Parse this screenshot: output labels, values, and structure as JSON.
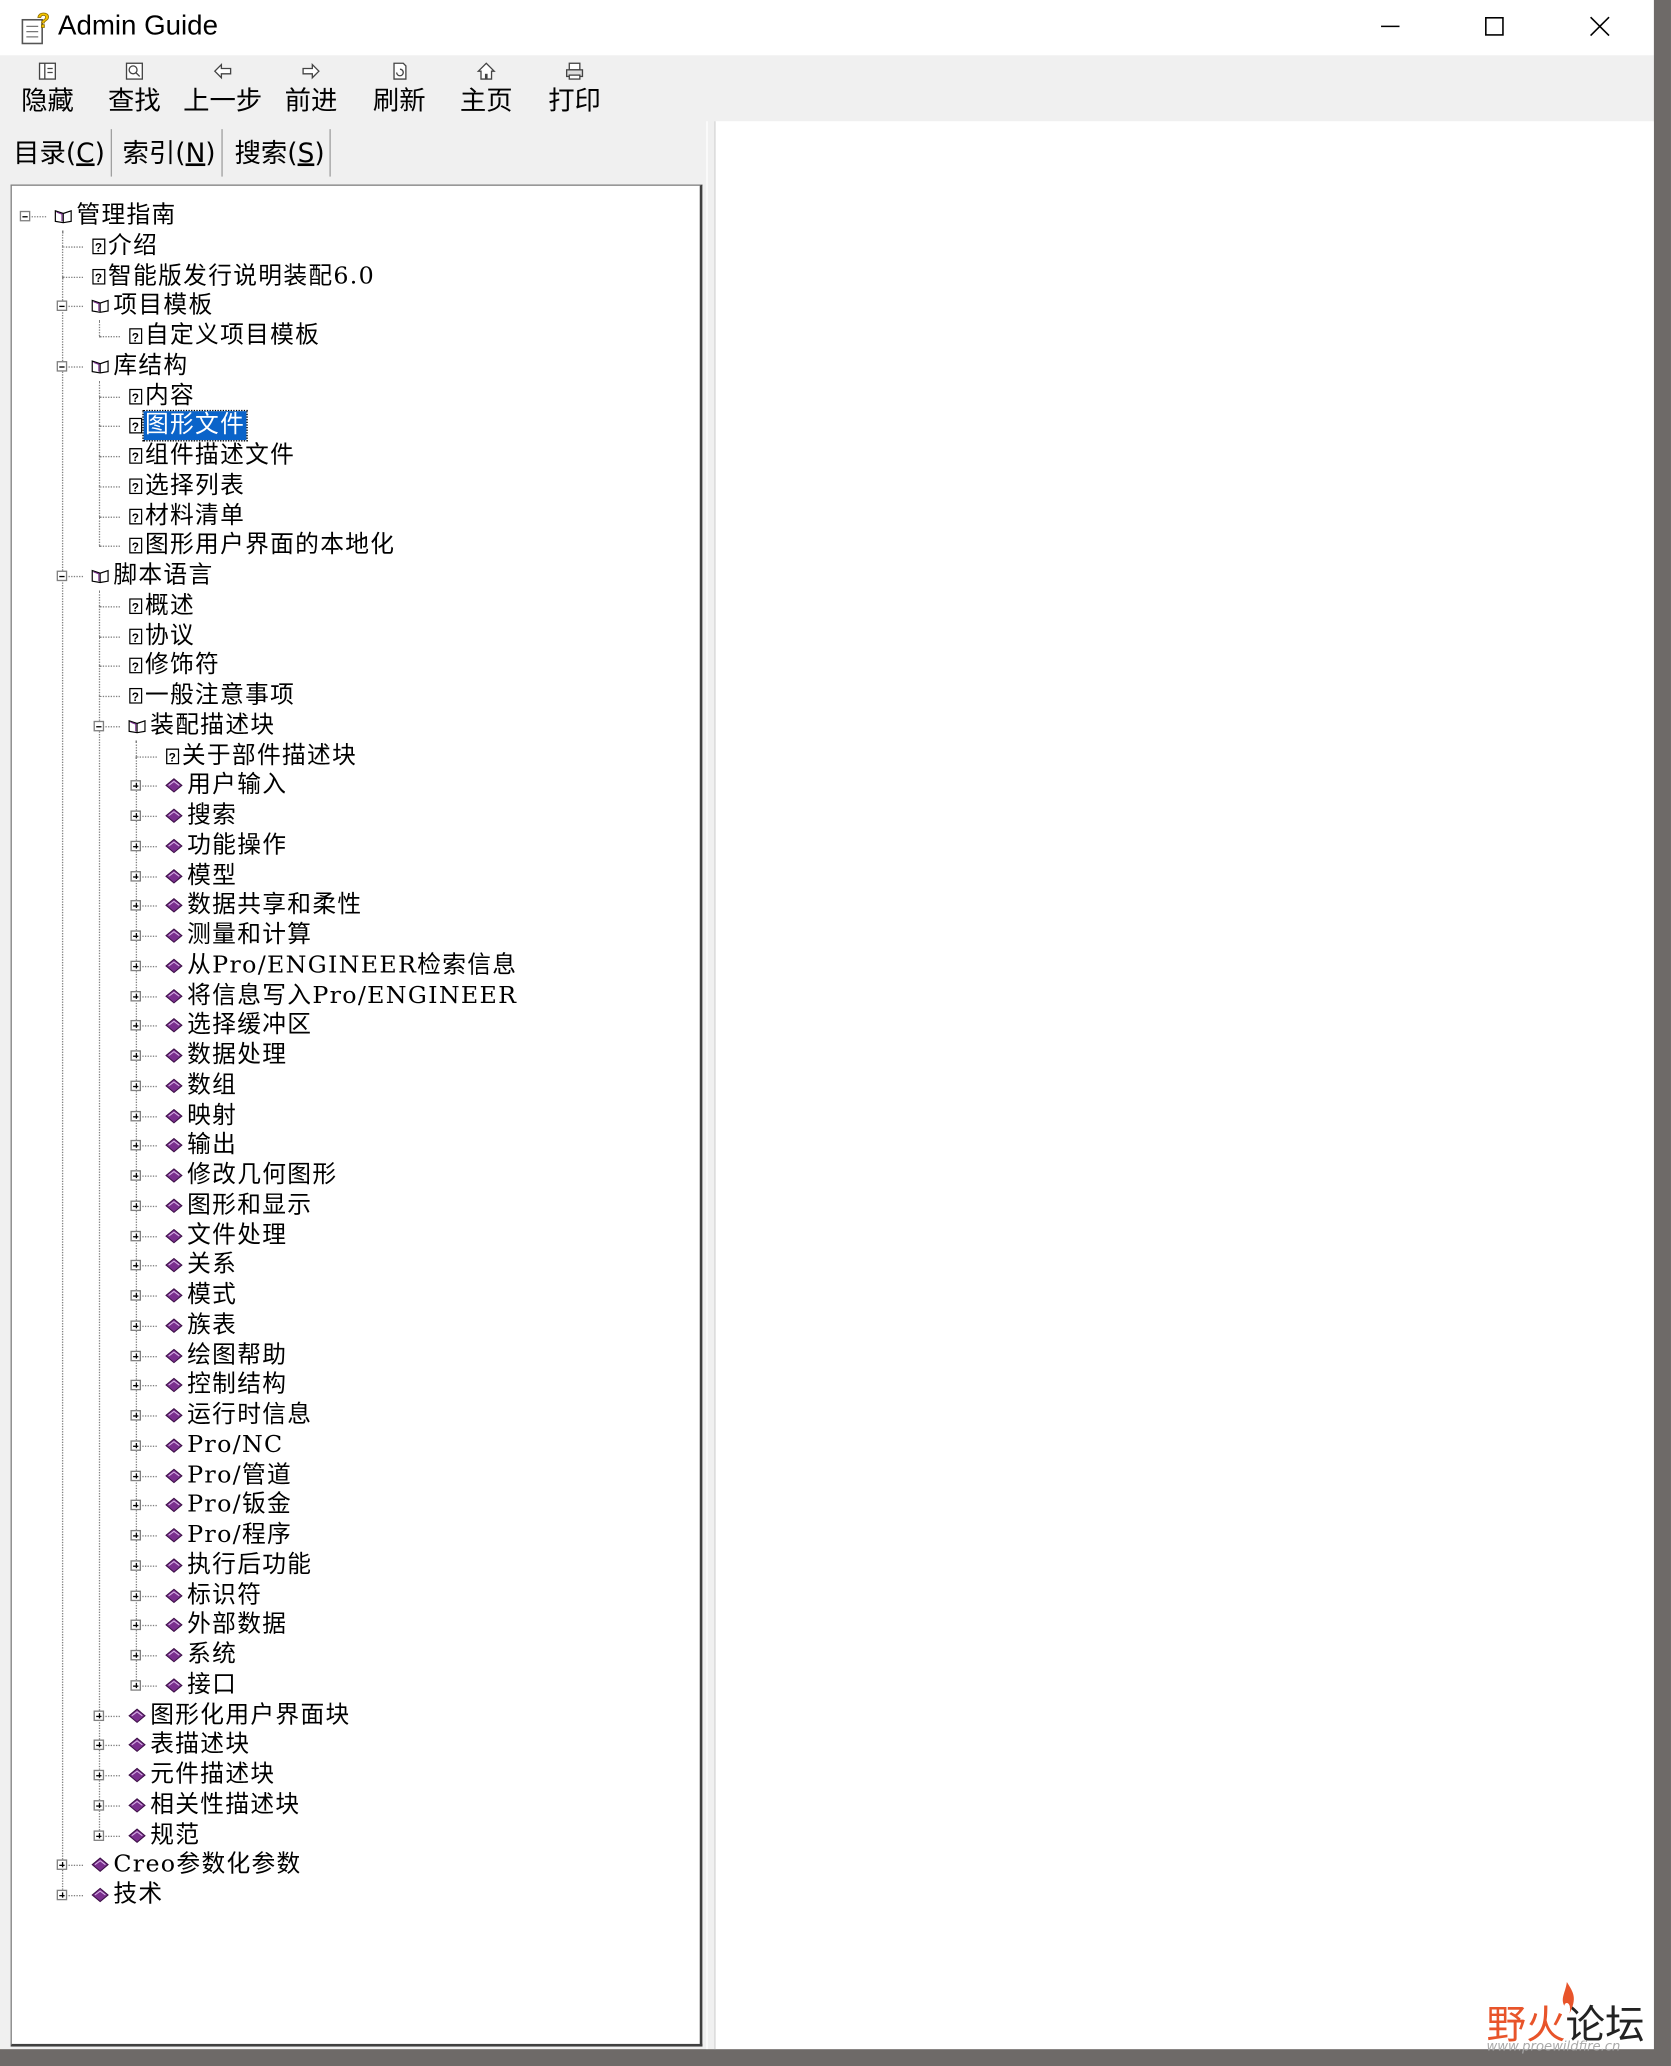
{
  "window": {
    "title": "Admin Guide"
  },
  "toolbar": [
    {
      "id": "hide",
      "label": "隐藏",
      "icon": "hide-icon"
    },
    {
      "id": "find",
      "label": "查找",
      "icon": "find-icon"
    },
    {
      "id": "back",
      "label": "上一步",
      "icon": "back-arrow-icon"
    },
    {
      "id": "forward",
      "label": "前进",
      "icon": "forward-arrow-icon"
    },
    {
      "id": "refresh",
      "label": "刷新",
      "icon": "refresh-icon"
    },
    {
      "id": "home",
      "label": "主页",
      "icon": "home-icon"
    },
    {
      "id": "print",
      "label": "打印",
      "icon": "print-icon"
    }
  ],
  "tabs": [
    {
      "label_pre": "目录(",
      "key": "C",
      "label_post": ")"
    },
    {
      "label_pre": "索引(",
      "key": "N",
      "label_post": ")"
    },
    {
      "label_pre": "搜索(",
      "key": "S",
      "label_post": ")"
    }
  ],
  "tree": [
    {
      "label": "管理指南",
      "level": 0,
      "kind": "open-book",
      "expander": "minus"
    },
    {
      "label": "介绍",
      "level": 1,
      "kind": "page"
    },
    {
      "label": "智能版发行说明装配6.0",
      "level": 1,
      "kind": "page"
    },
    {
      "label": "项目模板",
      "level": 1,
      "kind": "open-book",
      "expander": "minus"
    },
    {
      "label": "自定义项目模板",
      "level": 2,
      "kind": "page"
    },
    {
      "label": "库结构",
      "level": 1,
      "kind": "open-book",
      "expander": "minus"
    },
    {
      "label": "内容",
      "level": 2,
      "kind": "page"
    },
    {
      "label": "图形文件",
      "level": 2,
      "kind": "page",
      "selected": true
    },
    {
      "label": "组件描述文件",
      "level": 2,
      "kind": "page"
    },
    {
      "label": "选择列表",
      "level": 2,
      "kind": "page"
    },
    {
      "label": "材料清单",
      "level": 2,
      "kind": "page"
    },
    {
      "label": "图形用户界面的本地化",
      "level": 2,
      "kind": "page"
    },
    {
      "label": "脚本语言",
      "level": 1,
      "kind": "open-book",
      "expander": "minus"
    },
    {
      "label": "概述",
      "level": 2,
      "kind": "page"
    },
    {
      "label": "协议",
      "level": 2,
      "kind": "page"
    },
    {
      "label": "修饰符",
      "level": 2,
      "kind": "page"
    },
    {
      "label": "一般注意事项",
      "level": 2,
      "kind": "page"
    },
    {
      "label": "装配描述块",
      "level": 2,
      "kind": "open-book",
      "expander": "minus"
    },
    {
      "label": "关于部件描述块",
      "level": 3,
      "kind": "page"
    },
    {
      "label": "用户输入",
      "level": 3,
      "kind": "book",
      "expander": "plus"
    },
    {
      "label": "搜索",
      "level": 3,
      "kind": "book",
      "expander": "plus"
    },
    {
      "label": "功能操作",
      "level": 3,
      "kind": "book",
      "expander": "plus"
    },
    {
      "label": "模型",
      "level": 3,
      "kind": "book",
      "expander": "plus"
    },
    {
      "label": "数据共享和柔性",
      "level": 3,
      "kind": "book",
      "expander": "plus"
    },
    {
      "label": "测量和计算",
      "level": 3,
      "kind": "book",
      "expander": "plus"
    },
    {
      "label": "从Pro/ENGINEER检索信息",
      "level": 3,
      "kind": "book",
      "expander": "plus"
    },
    {
      "label": "将信息写入Pro/ENGINEER",
      "level": 3,
      "kind": "book",
      "expander": "plus"
    },
    {
      "label": "选择缓冲区",
      "level": 3,
      "kind": "book",
      "expander": "plus"
    },
    {
      "label": "数据处理",
      "level": 3,
      "kind": "book",
      "expander": "plus"
    },
    {
      "label": "数组",
      "level": 3,
      "kind": "book",
      "expander": "plus"
    },
    {
      "label": "映射",
      "level": 3,
      "kind": "book",
      "expander": "plus"
    },
    {
      "label": "输出",
      "level": 3,
      "kind": "book",
      "expander": "plus"
    },
    {
      "label": "修改几何图形",
      "level": 3,
      "kind": "book",
      "expander": "plus"
    },
    {
      "label": "图形和显示",
      "level": 3,
      "kind": "book",
      "expander": "plus"
    },
    {
      "label": "文件处理",
      "level": 3,
      "kind": "book",
      "expander": "plus"
    },
    {
      "label": "关系",
      "level": 3,
      "kind": "book",
      "expander": "plus"
    },
    {
      "label": "模式",
      "level": 3,
      "kind": "book",
      "expander": "plus"
    },
    {
      "label": "族表",
      "level": 3,
      "kind": "book",
      "expander": "plus"
    },
    {
      "label": "绘图帮助",
      "level": 3,
      "kind": "book",
      "expander": "plus"
    },
    {
      "label": "控制结构",
      "level": 3,
      "kind": "book",
      "expander": "plus"
    },
    {
      "label": "运行时信息",
      "level": 3,
      "kind": "book",
      "expander": "plus"
    },
    {
      "label": "Pro/NC",
      "level": 3,
      "kind": "book",
      "expander": "plus"
    },
    {
      "label": "Pro/管道",
      "level": 3,
      "kind": "book",
      "expander": "plus"
    },
    {
      "label": "Pro/钣金",
      "level": 3,
      "kind": "book",
      "expander": "plus"
    },
    {
      "label": "Pro/程序",
      "level": 3,
      "kind": "book",
      "expander": "plus"
    },
    {
      "label": "执行后功能",
      "level": 3,
      "kind": "book",
      "expander": "plus"
    },
    {
      "label": "标识符",
      "level": 3,
      "kind": "book",
      "expander": "plus"
    },
    {
      "label": "外部数据",
      "level": 3,
      "kind": "book",
      "expander": "plus"
    },
    {
      "label": "系统",
      "level": 3,
      "kind": "book",
      "expander": "plus"
    },
    {
      "label": "接口",
      "level": 3,
      "kind": "book",
      "expander": "plus"
    },
    {
      "label": "图形化用户界面块",
      "level": 2,
      "kind": "book",
      "expander": "plus"
    },
    {
      "label": "表描述块",
      "level": 2,
      "kind": "book",
      "expander": "plus"
    },
    {
      "label": "元件描述块",
      "level": 2,
      "kind": "book",
      "expander": "plus"
    },
    {
      "label": "相关性描述块",
      "level": 2,
      "kind": "book",
      "expander": "plus"
    },
    {
      "label": "规范",
      "level": 2,
      "kind": "book",
      "expander": "plus"
    },
    {
      "label": "Creo参数化参数",
      "level": 1,
      "kind": "book",
      "expander": "plus"
    },
    {
      "label": "技术",
      "level": 1,
      "kind": "book",
      "expander": "plus"
    }
  ],
  "watermark": {
    "text": "野火论坛",
    "url": "www.proewildfire.cn"
  },
  "colors": {
    "selection": "#0a63c9",
    "book": "#7a2f8e",
    "flame": "#e8542a"
  }
}
